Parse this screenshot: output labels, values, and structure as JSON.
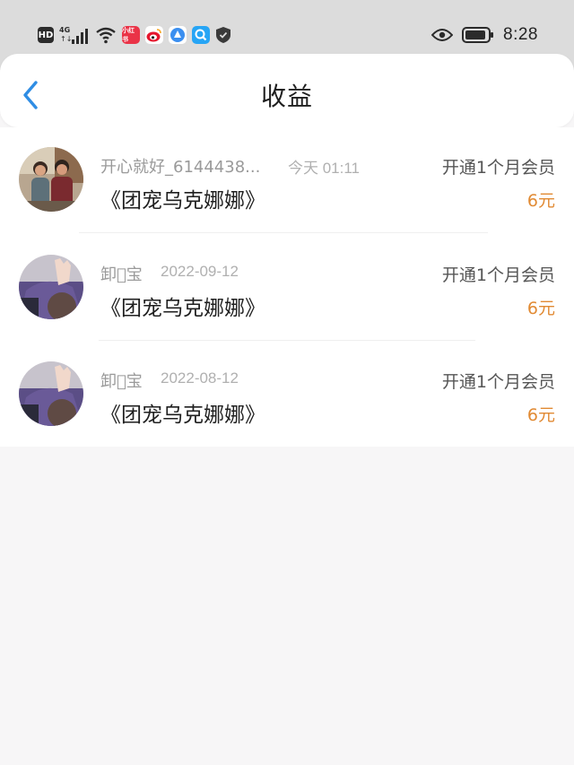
{
  "status_bar": {
    "hd_label": "HD",
    "network_label": "4G",
    "time": "8:28",
    "icons": [
      "hd-icon",
      "signal-icon",
      "wifi-icon",
      "xiaohongshu-app-icon",
      "weibo-app-icon",
      "browser-app-icon",
      "search-app-icon",
      "shield-icon",
      "eye-icon",
      "battery-icon"
    ]
  },
  "header": {
    "title": "收益",
    "back_icon": "chevron-left-icon"
  },
  "colors": {
    "accent": "#2f8de4",
    "amount": "#e18a33",
    "background": "#f7f6f7"
  },
  "earnings": [
    {
      "user": "开心就好_6144438...",
      "date": "今天 01:11",
      "title": "《团宠乌克娜娜》",
      "description": "开通1个月会员",
      "amount": "6元"
    },
    {
      "user": "卸\u0000宝",
      "date": "2022-09-12",
      "title": "《团宠乌克娜娜》",
      "description": "开通1个月会员",
      "amount": "6元"
    },
    {
      "user": "卸\u0000宝",
      "date": "2022-08-12",
      "title": "《团宠乌克娜娜》",
      "description": "开通1个月会员",
      "amount": "6元"
    }
  ]
}
